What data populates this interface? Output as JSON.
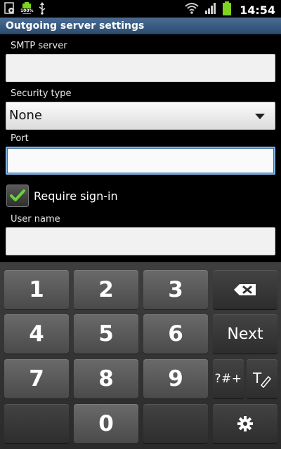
{
  "status_bar": {
    "time": "14:54",
    "left_icons": [
      "settings-app-icon",
      "battery-100-notification-icon",
      "usb-icon"
    ],
    "right_icons": [
      "wifi-icon",
      "signal-icon",
      "battery-icon"
    ],
    "battery_badge": "100%"
  },
  "titlebar": {
    "title": "Outgoing server settings"
  },
  "form": {
    "smtp_label": "SMTP server",
    "smtp_value": "",
    "security_label": "Security type",
    "security_value": "None",
    "port_label": "Port",
    "port_value": "",
    "require_signin_label": "Require sign-in",
    "require_signin_checked": true,
    "username_label": "User name",
    "username_value": ""
  },
  "keyboard": {
    "keys": {
      "k1": "1",
      "k2": "2",
      "k3": "3",
      "k4": "4",
      "k5": "5",
      "k6": "6",
      "k7": "7",
      "k8": "8",
      "k9": "9",
      "k0": "0",
      "next": "Next",
      "symbols": "?#+",
      "t9": "T"
    },
    "icons": [
      "backspace-icon",
      "handwriting-icon",
      "settings-gear-icon"
    ]
  },
  "colors": {
    "titlebar": "#2c4d72",
    "check": "#6cd13a",
    "focus_border": "#7fb2e6"
  }
}
